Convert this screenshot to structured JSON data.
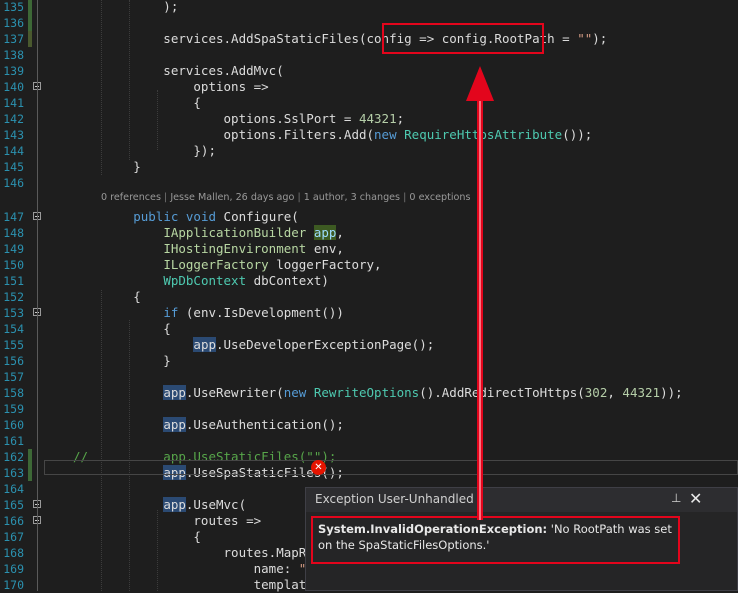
{
  "lines": [
    {
      "n": "135",
      "fold": false,
      "chg": "g",
      "parts": [
        {
          "t": "            );"
        }
      ]
    },
    {
      "n": "136",
      "fold": false,
      "chg": "g",
      "parts": [
        {
          "t": ""
        }
      ]
    },
    {
      "n": "137",
      "fold": false,
      "chg": "y",
      "parts": [
        {
          "t": "            services.AddSpaStaticFiles(config => config.RootPath = "
        },
        {
          "t": "\"\"",
          "c": "str"
        },
        {
          "t": ");"
        }
      ]
    },
    {
      "n": "138",
      "fold": false,
      "parts": [
        {
          "t": ""
        }
      ]
    },
    {
      "n": "139",
      "fold": false,
      "parts": [
        {
          "t": "            services.AddMvc("
        }
      ]
    },
    {
      "n": "140",
      "fold": true,
      "parts": [
        {
          "t": "                options =>"
        }
      ]
    },
    {
      "n": "141",
      "fold": false,
      "parts": [
        {
          "t": "                {"
        }
      ]
    },
    {
      "n": "142",
      "fold": false,
      "parts": [
        {
          "t": "                    options.SslPort = "
        },
        {
          "t": "44321",
          "c": "num"
        },
        {
          "t": ";"
        }
      ]
    },
    {
      "n": "143",
      "fold": false,
      "parts": [
        {
          "t": "                    options.Filters.Add("
        },
        {
          "t": "new",
          "c": "kw"
        },
        {
          "t": " "
        },
        {
          "t": "RequireHttpsAttribute",
          "c": "ty"
        },
        {
          "t": "());"
        }
      ]
    },
    {
      "n": "144",
      "fold": false,
      "parts": [
        {
          "t": "                });"
        }
      ]
    },
    {
      "n": "145",
      "fold": false,
      "parts": [
        {
          "t": "        }"
        }
      ]
    },
    {
      "n": "146",
      "fold": false,
      "parts": [
        {
          "t": ""
        }
      ]
    },
    {
      "n": "147",
      "fold": true,
      "parts": [
        {
          "t": "        "
        },
        {
          "t": "public",
          "c": "kw"
        },
        {
          "t": " "
        },
        {
          "t": "void",
          "c": "kw"
        },
        {
          "t": " Configure("
        }
      ]
    },
    {
      "n": "148",
      "fold": false,
      "parts": [
        {
          "t": "            "
        },
        {
          "t": "IApplicationBuilder",
          "c": "it"
        },
        {
          "t": " "
        },
        {
          "t": "app",
          "c": "par hl-par"
        },
        {
          "t": ","
        }
      ]
    },
    {
      "n": "149",
      "fold": false,
      "parts": [
        {
          "t": "            "
        },
        {
          "t": "IHostingEnvironment",
          "c": "it"
        },
        {
          "t": " env,"
        }
      ]
    },
    {
      "n": "150",
      "fold": false,
      "parts": [
        {
          "t": "            "
        },
        {
          "t": "ILoggerFactory",
          "c": "it"
        },
        {
          "t": " loggerFactory,"
        }
      ]
    },
    {
      "n": "151",
      "fold": false,
      "parts": [
        {
          "t": "            "
        },
        {
          "t": "WpDbContext",
          "c": "ty"
        },
        {
          "t": " dbContext)"
        }
      ]
    },
    {
      "n": "152",
      "fold": false,
      "parts": [
        {
          "t": "        {"
        }
      ]
    },
    {
      "n": "153",
      "fold": true,
      "parts": [
        {
          "t": "            "
        },
        {
          "t": "if",
          "c": "kw"
        },
        {
          "t": " (env.IsDevelopment())"
        }
      ]
    },
    {
      "n": "154",
      "fold": false,
      "parts": [
        {
          "t": "            {"
        }
      ]
    },
    {
      "n": "155",
      "fold": false,
      "parts": [
        {
          "t": "                "
        },
        {
          "t": "app",
          "c": "hl-app"
        },
        {
          "t": ".UseDeveloperExceptionPage();"
        }
      ]
    },
    {
      "n": "156",
      "fold": false,
      "parts": [
        {
          "t": "            }"
        }
      ]
    },
    {
      "n": "157",
      "fold": false,
      "parts": [
        {
          "t": ""
        }
      ]
    },
    {
      "n": "158",
      "fold": false,
      "parts": [
        {
          "t": "            "
        },
        {
          "t": "app",
          "c": "hl-app"
        },
        {
          "t": ".UseRewriter("
        },
        {
          "t": "new",
          "c": "kw"
        },
        {
          "t": " "
        },
        {
          "t": "RewriteOptions",
          "c": "ty"
        },
        {
          "t": "().AddRedirectToHttps("
        },
        {
          "t": "302",
          "c": "num"
        },
        {
          "t": ", "
        },
        {
          "t": "44321",
          "c": "num"
        },
        {
          "t": "));"
        }
      ]
    },
    {
      "n": "159",
      "fold": false,
      "parts": [
        {
          "t": ""
        }
      ]
    },
    {
      "n": "160",
      "fold": false,
      "parts": [
        {
          "t": "            "
        },
        {
          "t": "app",
          "c": "hl-app"
        },
        {
          "t": ".UseAuthentication();"
        }
      ]
    },
    {
      "n": "161",
      "fold": false,
      "parts": [
        {
          "t": ""
        }
      ]
    },
    {
      "n": "162",
      "fold": false,
      "chg": "g",
      "parts": [
        {
          "t": "//          app.UseStaticFiles(\"\");",
          "c": "cm"
        }
      ]
    },
    {
      "n": "163",
      "fold": false,
      "chg": "g",
      "parts": [
        {
          "t": "            "
        },
        {
          "t": "app",
          "c": "hl-app"
        },
        {
          "t": ".UseSpaStaticFiles();"
        }
      ]
    },
    {
      "n": "164",
      "fold": false,
      "parts": [
        {
          "t": ""
        }
      ]
    },
    {
      "n": "165",
      "fold": true,
      "parts": [
        {
          "t": "            "
        },
        {
          "t": "app",
          "c": "hl-app"
        },
        {
          "t": ".UseMvc("
        }
      ]
    },
    {
      "n": "166",
      "fold": true,
      "parts": [
        {
          "t": "                routes =>"
        }
      ]
    },
    {
      "n": "167",
      "fold": false,
      "parts": [
        {
          "t": "                {"
        }
      ]
    },
    {
      "n": "168",
      "fold": false,
      "parts": [
        {
          "t": "                    routes.MapRoute("
        }
      ]
    },
    {
      "n": "169",
      "fold": false,
      "parts": [
        {
          "t": "                        name: "
        },
        {
          "t": "\"defaul",
          "c": "str"
        }
      ]
    },
    {
      "n": "170",
      "fold": false,
      "parts": [
        {
          "t": "                        template: "
        },
        {
          "t": "\"{c",
          "c": "str"
        }
      ]
    }
  ],
  "codelens": {
    "refs": "0 references",
    "author": "Jesse Mallen, 26 days ago",
    "changes": "1 author, 3 changes",
    "exceptions": "0 exceptions",
    "separator": "|"
  },
  "popup": {
    "title": "Exception User-Unhandled",
    "pin_glyph": "⊥",
    "close_glyph": "✕",
    "exception_type": "System.InvalidOperationException:",
    "message": " 'No RootPath was set on the SpaStaticFilesOptions.'"
  },
  "error_glyph": "✕",
  "colors": {
    "annotation": "#e3051c",
    "line_numbers": "#2b91af",
    "keyword": "#569cd6",
    "type": "#4ec9b0",
    "string": "#d69d85"
  }
}
